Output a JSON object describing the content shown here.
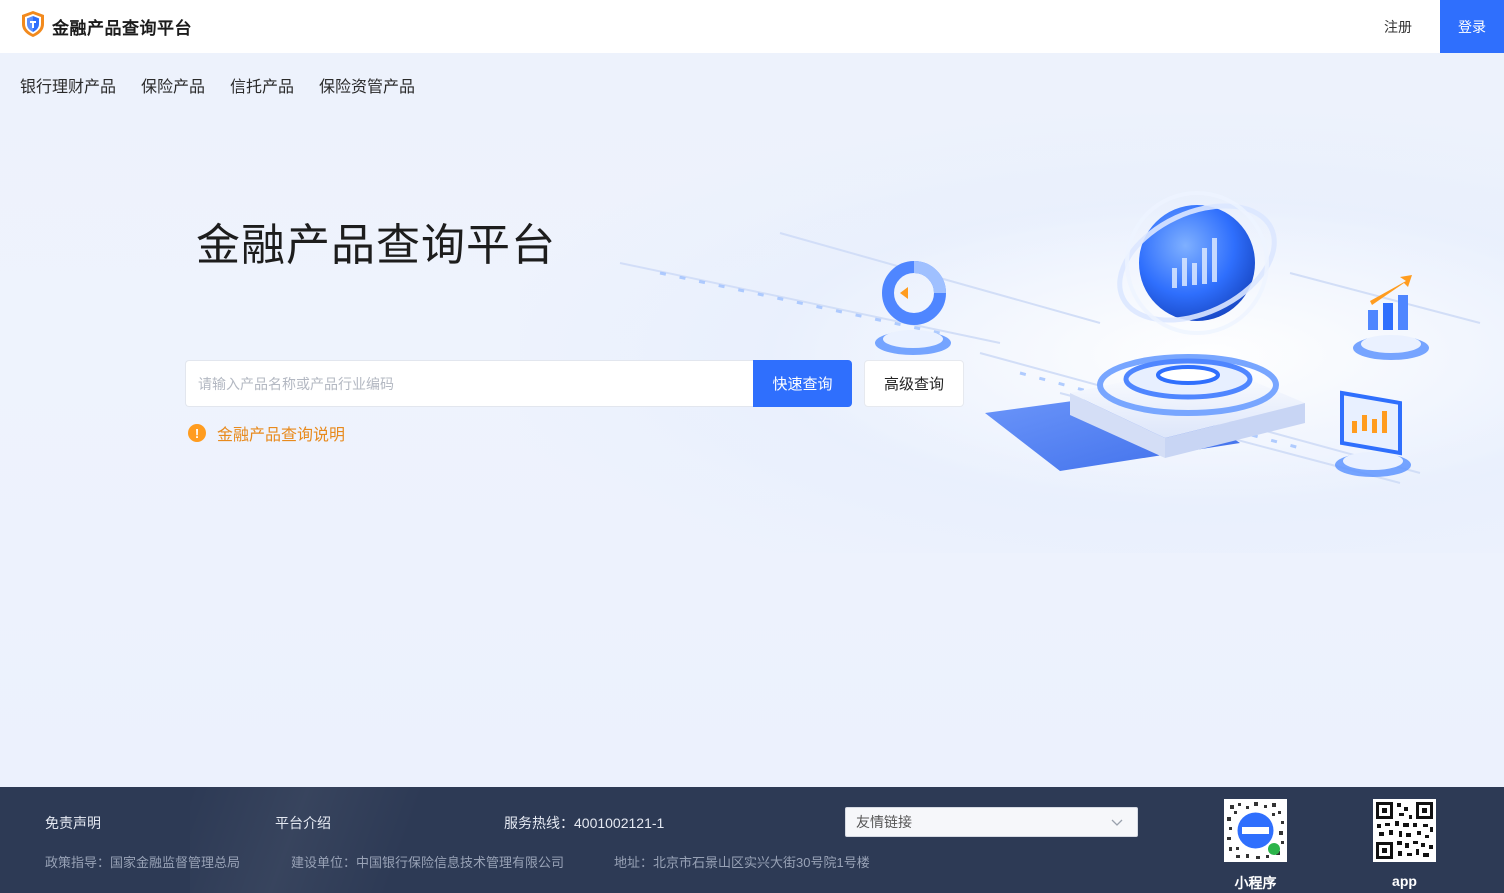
{
  "header": {
    "brand_title": "金融产品查询平台",
    "register_label": "注册",
    "login_label": "登录"
  },
  "nav": {
    "items": [
      {
        "label": "银行理财产品"
      },
      {
        "label": "保险产品"
      },
      {
        "label": "信托产品"
      },
      {
        "label": "保险资管产品"
      }
    ]
  },
  "hero": {
    "title": "金融产品查询平台"
  },
  "search": {
    "placeholder": "请输入产品名称或产品行业编码",
    "value": "",
    "quick_label": "快速查询",
    "advanced_label": "高级查询"
  },
  "notice": {
    "icon_glyph": "!",
    "text": "金融产品查询说明"
  },
  "footer": {
    "disclaimer": "免责声明",
    "about": "平台介绍",
    "hotline": "服务热线：4001002121-1",
    "friend_links_label": "友情链接",
    "guidance": "政策指导：国家金融监督管理总局",
    "builder": "建设单位：中国银行保险信息技术管理有限公司",
    "address": "地址：北京市石景山区实兴大街30号院1号楼",
    "qr_items": [
      {
        "label": "小程序"
      },
      {
        "label": "app"
      }
    ]
  },
  "colors": {
    "primary": "#2f6ffd",
    "notice": "#ff9c1f",
    "footer_bg": "#2d3a55"
  }
}
